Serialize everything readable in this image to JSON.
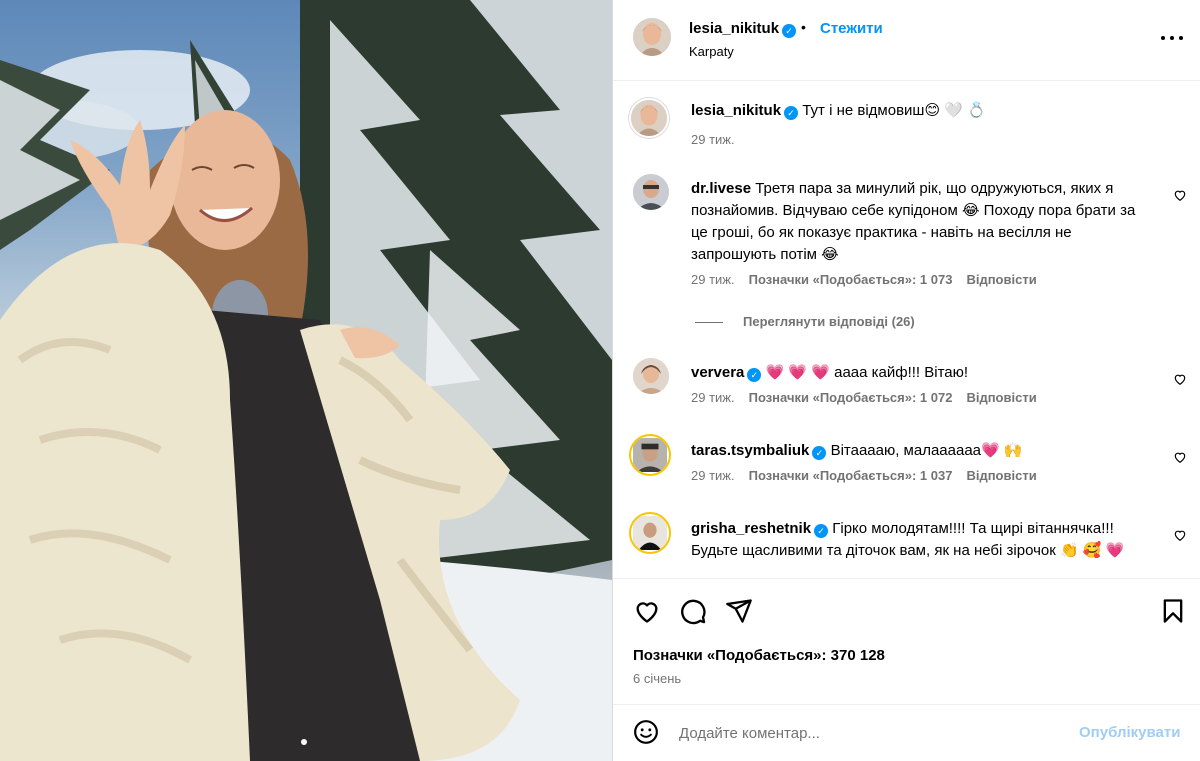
{
  "post": {
    "username": "lesia_nikituk",
    "follow_label": "Стежити",
    "separator": "•",
    "location": "Karpaty",
    "caption": "Тут і не відмовиш😊 🤍 💍",
    "caption_age": "29 тиж."
  },
  "comments": [
    {
      "username": "dr.livese",
      "text": "Третя пара за минулий рік, що одружуються, яких я познайомив. Відчуваю себе купідоном 😂 Походу пора брати за це гроші, бо як показує практика - навіть на весілля не запрошують потім 😂",
      "age": "29 тиж.",
      "likes": "Позначки «Подобається»: 1 073",
      "reply": "Відповісти"
    },
    {
      "username": "ververa",
      "text": "💗 💗 💗 аааа кайф!!! Вітаю!",
      "age": "29 тиж.",
      "likes": "Позначки «Подобається»: 1 072",
      "reply": "Відповісти"
    },
    {
      "username": "taras.tsymbaliuk",
      "text": "Вітааааю, малаааааа💗 🙌",
      "age": "29 тиж.",
      "likes": "Позначки «Подобається»: 1 037",
      "reply": "Відповісти"
    },
    {
      "username": "grisha_reshetnik",
      "text": "Гірко молодятам!!!! Та щирі вітаннячка!!! Будьте щасливими та діточок вам, як на небі зірочок 👏 🥰 💗"
    }
  ],
  "view_replies": "Переглянути відповіді (26)",
  "likes_total": "Позначки «Подобається»: 370 128",
  "post_date": "6 січень",
  "composer": {
    "placeholder": "Додайте коментар...",
    "post_label": "Опублікувати"
  },
  "colors": {
    "accent": "#0095f6",
    "muted": "#737373",
    "post_disabled": "#a0cdf6"
  },
  "icons": [
    "more-icon",
    "heart-icon",
    "comment-icon",
    "share-icon",
    "bookmark-icon",
    "emoji-icon",
    "verified-badge-icon"
  ]
}
